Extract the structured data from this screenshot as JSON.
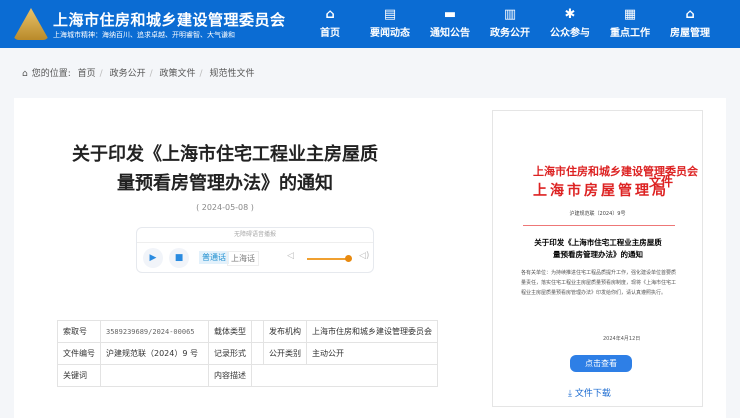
{
  "header": {
    "site_title": "上海市住房和城乡建设管理委员会",
    "motto": "上海城市精神：海纳百川、追求卓越、开明睿智、大气谦和",
    "nav": [
      {
        "label": "首页",
        "icon": "home-icon"
      },
      {
        "label": "要闻动态",
        "icon": "news-icon"
      },
      {
        "label": "通知公告",
        "icon": "folder-icon"
      },
      {
        "label": "政务公开",
        "icon": "chart-icon"
      },
      {
        "label": "公众参与",
        "icon": "gear-icon"
      },
      {
        "label": "重点工作",
        "icon": "building-icon"
      },
      {
        "label": "房屋管理",
        "icon": "house-icon"
      }
    ]
  },
  "breadcrumb": {
    "prefix": "您的位置:",
    "items": [
      "首页",
      "政务公开",
      "政策文件",
      "规范性文件"
    ]
  },
  "article": {
    "title_line1": "关于印发《上海市住宅工程业主房屋质",
    "title_line2": "量预看房管理办法》的通知",
    "date": "( 2024-05-08 )"
  },
  "audio": {
    "tip": "无障碍语音播报",
    "lang_active": "普通话",
    "lang_other": "上海话",
    "volume": 0.85
  },
  "meta_table": [
    [
      "索取号",
      "3589239689/2024-00065",
      "载体类型",
      "",
      "发布机构",
      "上海市住房和城乡建设管理委员会"
    ],
    [
      "文件编号",
      "沪建规范联（2024）9 号",
      "记录形式",
      "",
      "公开类别",
      "主动公开"
    ],
    [
      "关键词",
      "",
      "内容描述",
      "",
      "",
      ""
    ]
  ],
  "doc_preview": {
    "issuer1": "上海市住房和城乡建设管理委员会",
    "issuer2": "上海市房屋管理局",
    "wenjian": "文件",
    "doc_no": "沪建规范联〔2024〕9号",
    "title": "关于印发《上海市住宅工程业主房屋质量预看房管理办法》的通知",
    "body": "各有关单位：为持续推进住宅工程品质提升工作，强化建设单位首要质量责任，落实住宅工程业主房屋质量预看房制度，现将《上海市住宅工程业主房屋质量预看房管理办法》印发给你们，请认真遵照执行。",
    "sign_date": "2024年4月12日",
    "view_button": "点击查看",
    "download": "文件下载"
  }
}
